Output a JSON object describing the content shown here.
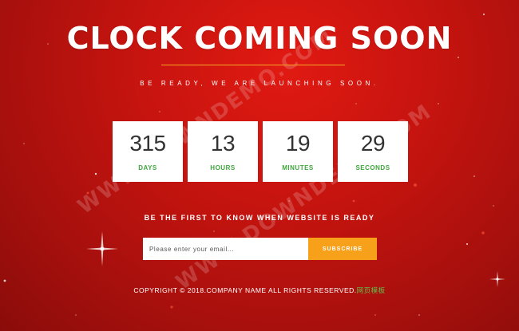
{
  "header": {
    "title": "CLOCK COMING SOON",
    "subtitle": "BE READY, WE ARE LAUNCHING SOON."
  },
  "countdown": [
    {
      "value": "315",
      "label": "DAYS"
    },
    {
      "value": "13",
      "label": "HOURS"
    },
    {
      "value": "19",
      "label": "MINUTES"
    },
    {
      "value": "29",
      "label": "SECONDS"
    }
  ],
  "notify": {
    "text": "BE THE FIRST TO KNOW WHEN WEBSITE IS READY",
    "email_placeholder": "Please enter your email...",
    "subscribe_label": "SUBSCRIBE"
  },
  "footer": {
    "copyright": "COPYRIGHT © 2018.COMPANY NAME ALL RIGHTS RESERVED.",
    "link_text": "网页模板"
  },
  "watermark": {
    "text_1": "WWW.DOWNDEMO.COM",
    "text_2": "WWW.DOWNDEMO.COM"
  },
  "colors": {
    "background": "#c8140f",
    "accent_orange": "#f7a01a",
    "label_green": "#3fa63d",
    "link_green": "#5fbf4a"
  }
}
